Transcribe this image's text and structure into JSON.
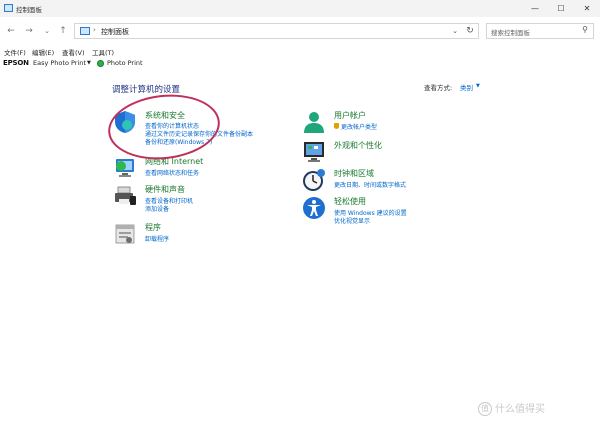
{
  "window": {
    "title": "控制面板",
    "minimize_glyph": "—",
    "maximize_glyph": "☐",
    "close_glyph": "✕"
  },
  "nav": {
    "back_glyph": "←",
    "forward_glyph": "→",
    "dropdown_glyph": "⌄",
    "up_glyph": "↑",
    "refresh_glyph": "↻"
  },
  "address": {
    "separator": "›",
    "crumb": "控制面板",
    "dropdown_glyph": "⌄"
  },
  "search": {
    "placeholder": "搜索控制面板",
    "icon_glyph": "⚲"
  },
  "menu": [
    "文件(F)",
    "编辑(E)",
    "查看(V)",
    "工具(T)"
  ],
  "epson": {
    "brand": "EPSON",
    "easy_photo_print": "Easy Photo Print",
    "arrow": "▼",
    "photo_print": "Photo Print"
  },
  "main": {
    "heading": "调整计算机的设置",
    "view_by_label": "查看方式:",
    "view_by_value": "类别",
    "view_by_arrow": "▼"
  },
  "left_categories": [
    {
      "title": "系统和安全",
      "icon": "shield-icon",
      "links": [
        "查看你的计算机状态",
        "通过文件历史记录保存你的文件备份副本",
        "备份和还原(Windows 7)"
      ]
    },
    {
      "title": "网络和 Internet",
      "icon": "network-icon",
      "links": [
        "查看网络状态和任务"
      ]
    },
    {
      "title": "硬件和声音",
      "icon": "printer-icon",
      "links": [
        "查看设备和打印机",
        "添加设备"
      ]
    },
    {
      "title": "程序",
      "icon": "programs-icon",
      "links": [
        "卸载程序"
      ]
    }
  ],
  "right_categories": [
    {
      "title": "用户帐户",
      "icon": "user-icon",
      "links": [
        "更改帐户类型"
      ]
    },
    {
      "title": "外观和个性化",
      "icon": "appearance-icon",
      "links": []
    },
    {
      "title": "时钟和区域",
      "icon": "clock-icon",
      "links": [
        "更改日期、时间或数字格式"
      ]
    },
    {
      "title": "轻松使用",
      "icon": "accessibility-icon",
      "links": [
        "使用 Windows 建议的设置",
        "优化视觉显示"
      ]
    }
  ],
  "watermark": {
    "logo_glyph": "值",
    "text": "什么值得买"
  },
  "colors": {
    "category_title": "#1a7a2e",
    "link": "#0066cc",
    "heading": "#1e3287",
    "highlight_oval": "#c0305b"
  }
}
